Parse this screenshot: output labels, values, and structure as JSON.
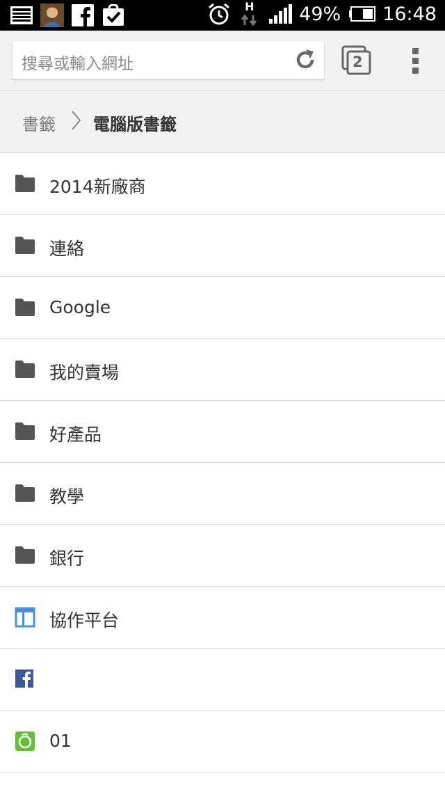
{
  "status_bar": {
    "battery_percent": "49%",
    "time": "16:48",
    "network_type": "H",
    "icons": [
      "gallery-icon",
      "avatar-notification-icon",
      "facebook-icon",
      "task-check-icon",
      "alarm-icon",
      "data-arrows-icon",
      "signal-icon",
      "battery-icon"
    ]
  },
  "toolbar": {
    "omnibox_placeholder": "搜尋或輸入網址",
    "tab_count": "2"
  },
  "breadcrumb": {
    "root": "書籤",
    "current": "電腦版書籤"
  },
  "bookmarks": [
    {
      "label": "2014新廠商",
      "icon": "folder-icon"
    },
    {
      "label": "連絡",
      "icon": "folder-icon"
    },
    {
      "label": "Google",
      "icon": "folder-icon"
    },
    {
      "label": "我的賣場",
      "icon": "folder-icon"
    },
    {
      "label": "好產品",
      "icon": "folder-icon"
    },
    {
      "label": "教學",
      "icon": "folder-icon"
    },
    {
      "label": "銀行",
      "icon": "folder-icon"
    },
    {
      "label": "協作平台",
      "icon": "sites-favicon-icon"
    },
    {
      "label": "",
      "icon": "facebook-favicon-icon"
    },
    {
      "label": "01",
      "icon": "green-favicon-icon"
    }
  ],
  "colors": {
    "folder": "#555555",
    "sites_blue": "#4a8fe0",
    "facebook_blue": "#3b5998",
    "green_favicon": "#62c13a"
  }
}
